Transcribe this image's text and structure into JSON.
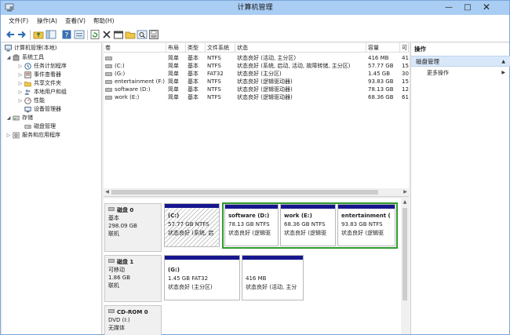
{
  "window": {
    "title": "计算机管理",
    "controls": {
      "minimize": "—",
      "maximize": "□",
      "close": "✕"
    }
  },
  "menubar": {
    "items": [
      "文件(F)",
      "操作(A)",
      "查看(V)",
      "帮助(H)"
    ]
  },
  "toolbar": {
    "icons": [
      "back-icon",
      "forward-icon",
      "up-folder-icon",
      "show-tree-icon",
      "help-icon",
      "properties-icon",
      "refresh-icon",
      "delete-icon",
      "properties-sheet-icon",
      "open-folder-icon",
      "search-icon",
      "disk-icon"
    ]
  },
  "tree": {
    "root": "计算机管理(本地)",
    "groups": [
      {
        "label": "系统工具",
        "children": [
          "任务计划程序",
          "事件查看器",
          "共享文件夹",
          "本地用户和组",
          "性能",
          "设备管理器"
        ]
      },
      {
        "label": "存储",
        "children": [
          "磁盘管理"
        ]
      },
      {
        "label": "服务和应用程序",
        "children": []
      }
    ]
  },
  "volumes": {
    "columns": [
      "卷",
      "布局",
      "类型",
      "文件系统",
      "状态",
      "容量",
      "可"
    ],
    "rows": [
      {
        "volume": "",
        "layout": "简单",
        "type": "基本",
        "fs": "NTFS",
        "status": "状态良好 (活动, 主分区)",
        "capacity": "416 MB",
        "free": "41"
      },
      {
        "volume": "(C:)",
        "layout": "简单",
        "type": "基本",
        "fs": "NTFS",
        "status": "状态良好 (系统, 启动, 活动, 故障转储, 主分区)",
        "capacity": "57.77 GB",
        "free": "15"
      },
      {
        "volume": "(G:)",
        "layout": "简单",
        "type": "基本",
        "fs": "FAT32",
        "status": "状态良好 (主分区)",
        "capacity": "1.45 GB",
        "free": "30"
      },
      {
        "volume": "entertainment (F:)",
        "layout": "简单",
        "type": "基本",
        "fs": "NTFS",
        "status": "状态良好 (逻辑驱动器)",
        "capacity": "93.83 GB",
        "free": "15"
      },
      {
        "volume": "software (D:)",
        "layout": "简单",
        "type": "基本",
        "fs": "NTFS",
        "status": "状态良好 (逻辑驱动器)",
        "capacity": "78.13 GB",
        "free": "12"
      },
      {
        "volume": "work (E:)",
        "layout": "简单",
        "type": "基本",
        "fs": "NTFS",
        "status": "状态良好 (逻辑驱动器)",
        "capacity": "68.36 GB",
        "free": "61"
      }
    ]
  },
  "disks": [
    {
      "name": "磁盘 0",
      "info": [
        "基本",
        "298.09 GB",
        "联机"
      ],
      "partitions": [
        {
          "title": "(C:)",
          "size": "57.77 GB NTFS",
          "status": "状态良好 (系统, 启"
        },
        {
          "title": "software  (D:)",
          "size": "78.13 GB NTFS",
          "status": "状态良好 (逻辑驱"
        },
        {
          "title": "work  (E:)",
          "size": "68.36 GB NTFS",
          "status": "状态良好 (逻辑驱"
        },
        {
          "title": "entertainment  (",
          "size": "93.83 GB NTFS",
          "status": "状态良好 (逻辑驱"
        }
      ]
    },
    {
      "name": "磁盘 1",
      "info": [
        "可移动",
        "1.86 GB",
        "联机"
      ],
      "partitions": [
        {
          "title": "(G:)",
          "size": "1.45 GB FAT32",
          "status": "状态良好 (主分区)"
        },
        {
          "title": "",
          "size": "416 MB",
          "status": "状态良好 (活动, 主分"
        }
      ]
    },
    {
      "name": "CD-ROM 0",
      "info": [
        "DVD (I:)",
        "",
        "无媒体"
      ],
      "partitions": []
    }
  ],
  "actions": {
    "header": "操作",
    "section": "磁盘管理",
    "items": [
      "更多操作"
    ]
  },
  "colors": {
    "titlebar": "#a9cdf3",
    "partition_bar": "#16168f",
    "extended_border": "#2f9b2f",
    "action_section": "#d9e8f9"
  }
}
